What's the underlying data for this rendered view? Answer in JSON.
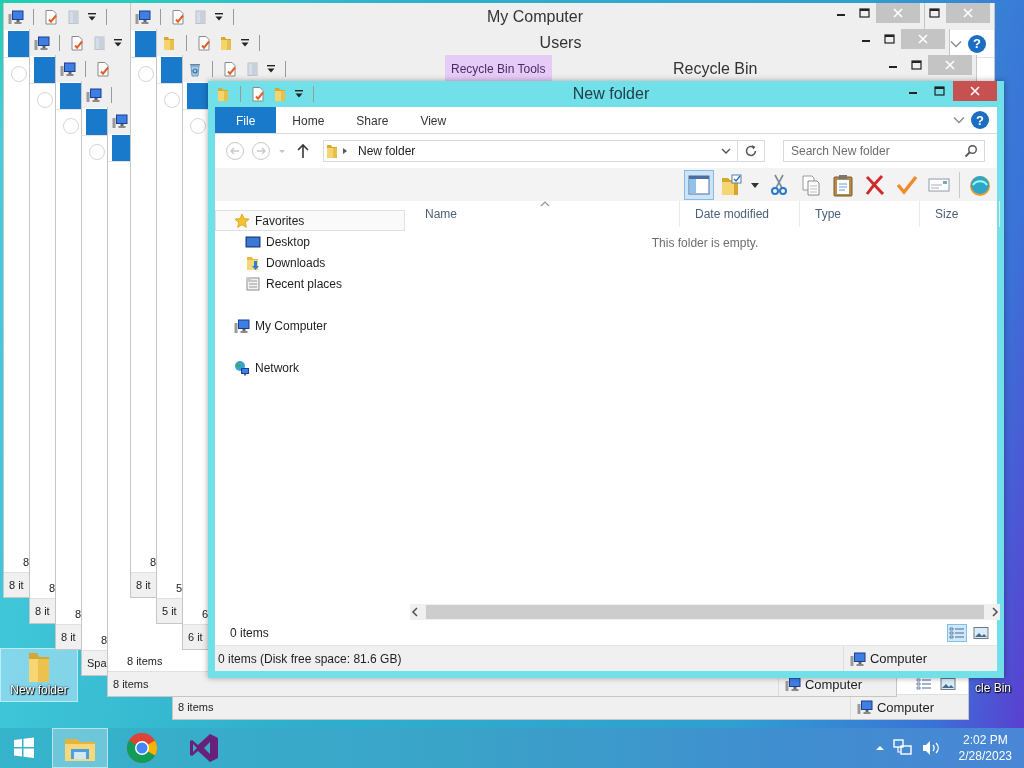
{
  "desktop": {
    "icons": [
      {
        "label": "New folder",
        "kind": "folder",
        "selected": true
      },
      {
        "label": "cle Bin",
        "selected": false
      }
    ]
  },
  "background_windows": [
    {
      "kind": "recycle",
      "active": false,
      "title": "Recycle Bin",
      "context_tab": "Recycle Bin Tools",
      "controls": [
        {
          "kind": "minimize"
        },
        {
          "kind": "maximize"
        },
        {
          "kind": "close"
        }
      ],
      "pane_count": "6",
      "status": "6 it"
    },
    {
      "kind": "folder",
      "active": false,
      "title": "Users",
      "controls": [
        {
          "kind": "minimize"
        },
        {
          "kind": "maximize"
        },
        {
          "kind": "close"
        }
      ],
      "pane_count": "5",
      "status": "5 it"
    },
    {
      "kind": "computer",
      "active": false,
      "title": "My Computer",
      "controls": [
        {
          "kind": "minimize"
        },
        {
          "kind": "maximize"
        },
        {
          "kind": "close"
        }
      ],
      "pane_count": "8",
      "status": "8 it"
    },
    {
      "kind": "computer",
      "active": false,
      "pane_count": "8 items",
      "status": "8 items",
      "location": "Computer"
    },
    {
      "kind": "computer",
      "active": false,
      "pane_count": "8",
      "status": "Spa"
    },
    {
      "kind": "computer",
      "active": false,
      "pane_count": "8",
      "status": "8 it"
    },
    {
      "kind": "computer",
      "active": false,
      "pane_count": "8",
      "status": "8 it"
    },
    {
      "kind": "computer",
      "active": false,
      "controls": [
        {
          "kind": "maximize"
        },
        {
          "kind": "close"
        }
      ],
      "ribbon_controls": [
        {
          "kind": "expand"
        },
        {
          "kind": "help",
          "label": "?"
        }
      ],
      "pane_count": "8",
      "status": "8 it"
    },
    {
      "status": "8 items",
      "location": "Computer",
      "views": [
        {
          "kind": "details",
          "selected": false
        },
        {
          "kind": "large-icons",
          "selected": false
        }
      ]
    }
  ],
  "window": {
    "kind": "folder",
    "active": true,
    "title": "New folder",
    "controls": [
      {
        "kind": "minimize"
      },
      {
        "kind": "maximize"
      },
      {
        "kind": "close"
      }
    ],
    "ribbon_tabs": [
      {
        "label": "File",
        "kind": "file",
        "selected": false
      },
      {
        "label": "Home",
        "kind": "tab",
        "selected": false
      },
      {
        "label": "Share",
        "kind": "tab",
        "selected": false
      },
      {
        "label": "View",
        "kind": "tab",
        "selected": false
      }
    ],
    "ribbon_controls": [
      {
        "kind": "expand"
      },
      {
        "kind": "help",
        "label": "?"
      }
    ],
    "navigation": {
      "back": {
        "disabled": true
      },
      "forward": {
        "disabled": true
      },
      "up": {
        "disabled": false
      }
    },
    "address": {
      "location": "New folder"
    },
    "search": {
      "placeholder": "Search New folder"
    },
    "toolbar": [
      {
        "kind": "layout",
        "on": true
      },
      {
        "kind": "folder-options"
      },
      {
        "kind": "menu-caret"
      },
      {
        "kind": "cut"
      },
      {
        "kind": "copy"
      },
      {
        "kind": "paste"
      },
      {
        "kind": "delete"
      },
      {
        "kind": "check"
      },
      {
        "kind": "rename"
      },
      {
        "kind": "separator"
      },
      {
        "kind": "shell"
      }
    ],
    "sidebar": {
      "items": [
        {
          "label": "Favorites",
          "kind": "star",
          "selected": true,
          "children": [
            {
              "label": "Desktop",
              "kind": "desktop",
              "selected": false
            },
            {
              "label": "Downloads",
              "kind": "downloads",
              "selected": false
            },
            {
              "label": "Recent places",
              "kind": "recent",
              "selected": false
            }
          ]
        },
        {
          "label": "My Computer",
          "kind": "computer",
          "selected": false
        },
        {
          "label": "Network",
          "kind": "network",
          "selected": false
        }
      ]
    },
    "columns": [
      {
        "label": "Name",
        "sorted": true
      },
      {
        "label": "Date modified",
        "sorted": false
      },
      {
        "label": "Type",
        "sorted": false
      },
      {
        "label": "Size",
        "sorted": false
      }
    ],
    "empty_message": "This folder is empty.",
    "item_count": "0 items",
    "views": [
      {
        "kind": "details",
        "selected": true
      },
      {
        "kind": "large-icons",
        "selected": false
      }
    ],
    "status": "0 items (Disk free space: 81.6 GB)",
    "location": "Computer"
  },
  "taskbar": {
    "apps": [
      {
        "kind": "explorer",
        "active": true
      },
      {
        "kind": "chrome",
        "active": false
      },
      {
        "kind": "visual-studio",
        "active": false
      }
    ],
    "tray": [
      {
        "kind": "show-hidden"
      },
      {
        "kind": "network"
      },
      {
        "kind": "volume"
      }
    ],
    "time": "2:02 PM",
    "date": "2/28/2023"
  }
}
